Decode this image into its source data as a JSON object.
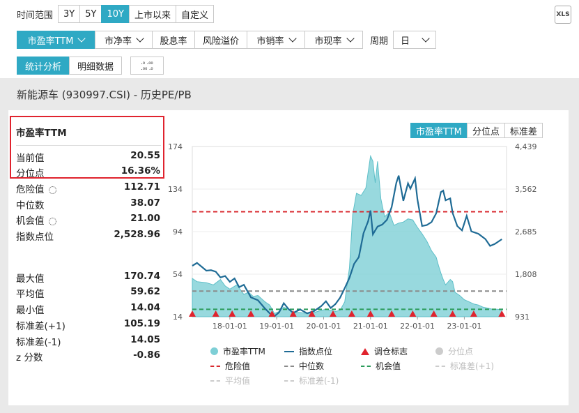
{
  "time_range": {
    "label": "时间范围",
    "options": [
      "3Y",
      "5Y",
      "10Y",
      "上市以来",
      "自定义"
    ],
    "active": "10Y"
  },
  "metrics": {
    "options": [
      "市盈率TTM",
      "市净率",
      "股息率",
      "风险溢价",
      "市销率",
      "市现率"
    ],
    "active": "市盈率TTM",
    "period_label": "周期",
    "period_value": "日"
  },
  "view": {
    "options": [
      "统计分析",
      "明细数据"
    ],
    "active": "统计分析",
    "decimal_icon": "decimal-adjust-icon"
  },
  "export_label": "XLS",
  "page_title": "新能源车 (930997.CSI) - 历史PE/PB",
  "stats": {
    "header": "市盈率TTM",
    "current": {
      "label": "当前值",
      "value": "20.55"
    },
    "percentile": {
      "label": "分位点",
      "value": "16.36%"
    },
    "danger": {
      "label": "危险值",
      "value": "112.71"
    },
    "median": {
      "label": "中位数",
      "value": "38.07"
    },
    "opportunity": {
      "label": "机会值",
      "value": "21.00"
    },
    "index_point": {
      "label": "指数点位",
      "value": "2,528.96"
    },
    "max": {
      "label": "最大值",
      "value": "170.74"
    },
    "mean": {
      "label": "平均值",
      "value": "59.62"
    },
    "min": {
      "label": "最小值",
      "value": "14.04"
    },
    "std_plus": {
      "label": "标准差(+1)",
      "value": "105.19"
    },
    "std_minus": {
      "label": "标准差(-1)",
      "value": "14.05"
    },
    "z": {
      "label": "z 分数",
      "value": "-0.86"
    }
  },
  "chart_tabs": {
    "options": [
      "市盈率TTM",
      "分位点",
      "标准差"
    ],
    "active": "市盈率TTM"
  },
  "chart_data": {
    "type": "area",
    "x_ticks": [
      "18-01-01",
      "19-01-01",
      "20-01-01",
      "21-01-01",
      "22-01-01",
      "23-01-01"
    ],
    "y_left_ticks": [
      "174",
      "134",
      "94",
      "54",
      "14"
    ],
    "y_right_ticks": [
      "4,439",
      "3,562",
      "2,685",
      "1,808",
      "931"
    ],
    "ylim_left": [
      14,
      174
    ],
    "ylim_right": [
      931,
      4439
    ],
    "xlim": [
      2017.2,
      2023.9
    ],
    "series": [
      {
        "name": "市盈率TTM",
        "axis": "left",
        "color": "#7ecfd6",
        "points": [
          [
            2017.2,
            50
          ],
          [
            2017.3,
            47
          ],
          [
            2017.5,
            46
          ],
          [
            2017.65,
            44
          ],
          [
            2017.8,
            49
          ],
          [
            2017.9,
            43
          ],
          [
            2018.0,
            40
          ],
          [
            2018.15,
            44
          ],
          [
            2018.3,
            35
          ],
          [
            2018.4,
            37
          ],
          [
            2018.5,
            33
          ],
          [
            2018.6,
            34
          ],
          [
            2018.75,
            28
          ],
          [
            2018.85,
            25
          ],
          [
            2018.95,
            17
          ],
          [
            2019.05,
            19
          ],
          [
            2019.15,
            23
          ],
          [
            2019.25,
            21
          ],
          [
            2019.35,
            18
          ],
          [
            2019.5,
            18
          ],
          [
            2019.65,
            17
          ],
          [
            2019.8,
            18
          ],
          [
            2019.95,
            20
          ],
          [
            2020.05,
            21
          ],
          [
            2020.15,
            20
          ],
          [
            2020.25,
            19
          ],
          [
            2020.35,
            20
          ],
          [
            2020.45,
            28
          ],
          [
            2020.55,
            60
          ],
          [
            2020.62,
            110
          ],
          [
            2020.7,
            130
          ],
          [
            2020.8,
            128
          ],
          [
            2020.9,
            135
          ],
          [
            2020.95,
            150
          ],
          [
            2021.0,
            165
          ],
          [
            2021.05,
            160
          ],
          [
            2021.1,
            140
          ],
          [
            2021.15,
            160
          ],
          [
            2021.22,
            125
          ],
          [
            2021.3,
            108
          ],
          [
            2021.4,
            112
          ],
          [
            2021.5,
            100
          ],
          [
            2021.6,
            102
          ],
          [
            2021.7,
            103
          ],
          [
            2021.8,
            106
          ],
          [
            2021.9,
            105
          ],
          [
            2022.0,
            98
          ],
          [
            2022.1,
            92
          ],
          [
            2022.2,
            85
          ],
          [
            2022.3,
            76
          ],
          [
            2022.4,
            70
          ],
          [
            2022.45,
            62
          ],
          [
            2022.5,
            55
          ],
          [
            2022.55,
            49
          ],
          [
            2022.6,
            44
          ],
          [
            2022.7,
            49
          ],
          [
            2022.75,
            47
          ],
          [
            2022.8,
            37
          ],
          [
            2022.9,
            34
          ],
          [
            2023.0,
            30
          ],
          [
            2023.1,
            28
          ],
          [
            2023.2,
            26
          ],
          [
            2023.3,
            25
          ],
          [
            2023.4,
            23
          ],
          [
            2023.5,
            22
          ],
          [
            2023.6,
            21
          ],
          [
            2023.7,
            21
          ],
          [
            2023.8,
            20.6
          ]
        ]
      },
      {
        "name": "指数点位",
        "axis": "right",
        "color": "#1f6b95",
        "points": [
          [
            2017.2,
            1980
          ],
          [
            2017.3,
            2040
          ],
          [
            2017.4,
            1960
          ],
          [
            2017.5,
            1880
          ],
          [
            2017.6,
            1890
          ],
          [
            2017.7,
            1860
          ],
          [
            2017.8,
            1740
          ],
          [
            2017.9,
            1770
          ],
          [
            2018.0,
            1650
          ],
          [
            2018.1,
            1720
          ],
          [
            2018.2,
            1540
          ],
          [
            2018.3,
            1590
          ],
          [
            2018.45,
            1330
          ],
          [
            2018.6,
            1270
          ],
          [
            2018.75,
            1100
          ],
          [
            2018.85,
            1000
          ],
          [
            2018.95,
            940
          ],
          [
            2019.05,
            1020
          ],
          [
            2019.15,
            1210
          ],
          [
            2019.25,
            1090
          ],
          [
            2019.35,
            1010
          ],
          [
            2019.5,
            1080
          ],
          [
            2019.65,
            1000
          ],
          [
            2019.8,
            1050
          ],
          [
            2019.95,
            1150
          ],
          [
            2020.05,
            1250
          ],
          [
            2020.15,
            1110
          ],
          [
            2020.25,
            1190
          ],
          [
            2020.35,
            1320
          ],
          [
            2020.45,
            1520
          ],
          [
            2020.55,
            1730
          ],
          [
            2020.65,
            2020
          ],
          [
            2020.75,
            2160
          ],
          [
            2020.85,
            2650
          ],
          [
            2020.95,
            2900
          ],
          [
            2021.0,
            3120
          ],
          [
            2021.05,
            2630
          ],
          [
            2021.15,
            2790
          ],
          [
            2021.25,
            2830
          ],
          [
            2021.35,
            2930
          ],
          [
            2021.45,
            3190
          ],
          [
            2021.55,
            3690
          ],
          [
            2021.6,
            3840
          ],
          [
            2021.7,
            3320
          ],
          [
            2021.8,
            3680
          ],
          [
            2021.85,
            3570
          ],
          [
            2021.95,
            3780
          ],
          [
            2022.0,
            3350
          ],
          [
            2022.1,
            2800
          ],
          [
            2022.2,
            2820
          ],
          [
            2022.3,
            2880
          ],
          [
            2022.4,
            3060
          ],
          [
            2022.5,
            3500
          ],
          [
            2022.55,
            3530
          ],
          [
            2022.6,
            3330
          ],
          [
            2022.7,
            3370
          ],
          [
            2022.75,
            3070
          ],
          [
            2022.85,
            2800
          ],
          [
            2022.95,
            2710
          ],
          [
            2023.05,
            3010
          ],
          [
            2023.15,
            2690
          ],
          [
            2023.3,
            2640
          ],
          [
            2023.45,
            2530
          ],
          [
            2023.55,
            2390
          ],
          [
            2023.65,
            2430
          ],
          [
            2023.8,
            2529
          ]
        ]
      }
    ],
    "reference_lines": [
      {
        "name": "危险值",
        "value": 112.71,
        "color": "#d8292f",
        "axis": "left"
      },
      {
        "name": "中位数",
        "value": 38.07,
        "color": "#8a8a8a",
        "axis": "left"
      },
      {
        "name": "机会值",
        "value": 21.0,
        "color": "#2a9b5a",
        "axis": "left"
      }
    ],
    "rebalance_markers": {
      "name": "调仓标志",
      "color": "#e0232e",
      "x": [
        2017.2,
        2017.7,
        2018.05,
        2018.45,
        2018.9,
        2019.35,
        2019.75,
        2020.2,
        2020.6,
        2021.0,
        2021.45,
        2021.9,
        2022.35,
        2022.75,
        2023.2,
        2023.8
      ]
    },
    "legend": [
      {
        "name": "市盈率TTM",
        "symbol": "dot",
        "color": "#7ecfd6",
        "enabled": true
      },
      {
        "name": "指数点位",
        "symbol": "line",
        "color": "#1f6b95",
        "enabled": true
      },
      {
        "name": "调仓标志",
        "symbol": "triangle",
        "color": "#e0232e",
        "enabled": true
      },
      {
        "name": "分位点",
        "symbol": "dot",
        "color": "#ccc",
        "enabled": false
      },
      {
        "name": "危险值",
        "symbol": "dash",
        "color": "#d8292f",
        "enabled": true
      },
      {
        "name": "中位数",
        "symbol": "dash",
        "color": "#8a8a8a",
        "enabled": true
      },
      {
        "name": "机会值",
        "symbol": "dash",
        "color": "#2a9b5a",
        "enabled": true
      },
      {
        "name": "标准差(+1)",
        "symbol": "dash",
        "color": "#ccc",
        "enabled": false
      },
      {
        "name": "平均值",
        "symbol": "dash",
        "color": "#ccc",
        "enabled": false
      },
      {
        "name": "标准差(-1)",
        "symbol": "dash",
        "color": "#ccc",
        "enabled": false
      }
    ]
  }
}
